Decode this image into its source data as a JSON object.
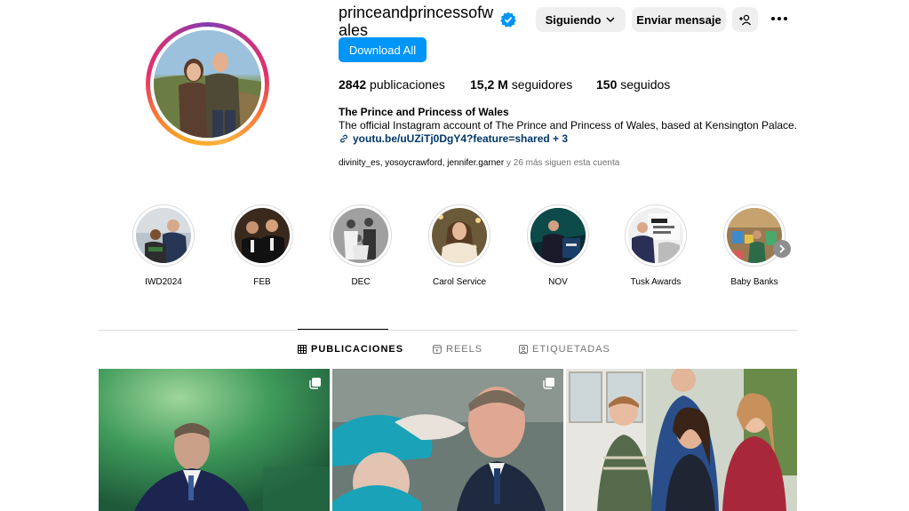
{
  "profile": {
    "username": "princeandprincessofwales",
    "verified_icon": "verified-badge-icon",
    "buttons": {
      "following": "Siguiendo",
      "message": "Enviar mensaje",
      "download": "Download All"
    },
    "stats": {
      "posts_count": "2842",
      "posts_label": "publicaciones",
      "followers_count": "15,2 M",
      "followers_label": "seguidores",
      "following_count": "150",
      "following_label": "seguidos"
    },
    "full_name": "The Prince and Princess of Wales",
    "bio": "The official Instagram account of The Prince and Princess of Wales, based at Kensington Palace.",
    "link": "youtu.be/uUZiTj0DgY4?feature=shared + 3",
    "followed_by": {
      "names": "divinity_es, yosoycrawford, jennifer.garner",
      "suffix": " y 26 más siguen esta cuenta"
    }
  },
  "highlights": [
    {
      "label": "IWD2024"
    },
    {
      "label": "FEB"
    },
    {
      "label": "DEC"
    },
    {
      "label": "Carol Service"
    },
    {
      "label": "NOV"
    },
    {
      "label": "Tusk Awards"
    },
    {
      "label": "Baby Banks"
    }
  ],
  "tabs": [
    {
      "label": "PUBLICACIONES",
      "icon": "grid-icon",
      "active": true
    },
    {
      "label": "REELS",
      "icon": "reels-icon",
      "active": false
    },
    {
      "label": "ETIQUETADAS",
      "icon": "tagged-icon",
      "active": false
    }
  ],
  "colors": {
    "accent_blue": "#0095f6",
    "link_blue": "#00376b",
    "button_gray": "#efefef",
    "divider": "#dbdbdb",
    "muted_text": "#737373"
  }
}
